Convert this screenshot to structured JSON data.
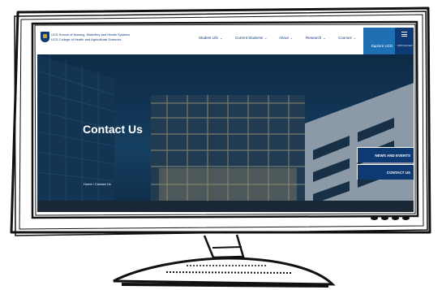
{
  "brand": {
    "line1": "UCD School of Nursing, Midwifery and Health Systems",
    "line2": "UCD College of Health and Agricultural Sciences"
  },
  "nav": {
    "items": [
      {
        "label": "Student Life"
      },
      {
        "label": "Current Students"
      },
      {
        "label": "About"
      },
      {
        "label": "Research"
      },
      {
        "label": "Courses"
      }
    ],
    "explore_label": "Explore UCD",
    "menu_label": "UCD Connect"
  },
  "hero": {
    "title": "Contact Us",
    "breadcrumb": "Home / Contact Us"
  },
  "side_buttons": {
    "news": "NEWS AND EVENTS",
    "contact": "CONTACT US"
  },
  "colors": {
    "brand_navy": "#0e3a74",
    "explore_blue": "#1f6fb5",
    "accent_gold": "#c9a227"
  }
}
